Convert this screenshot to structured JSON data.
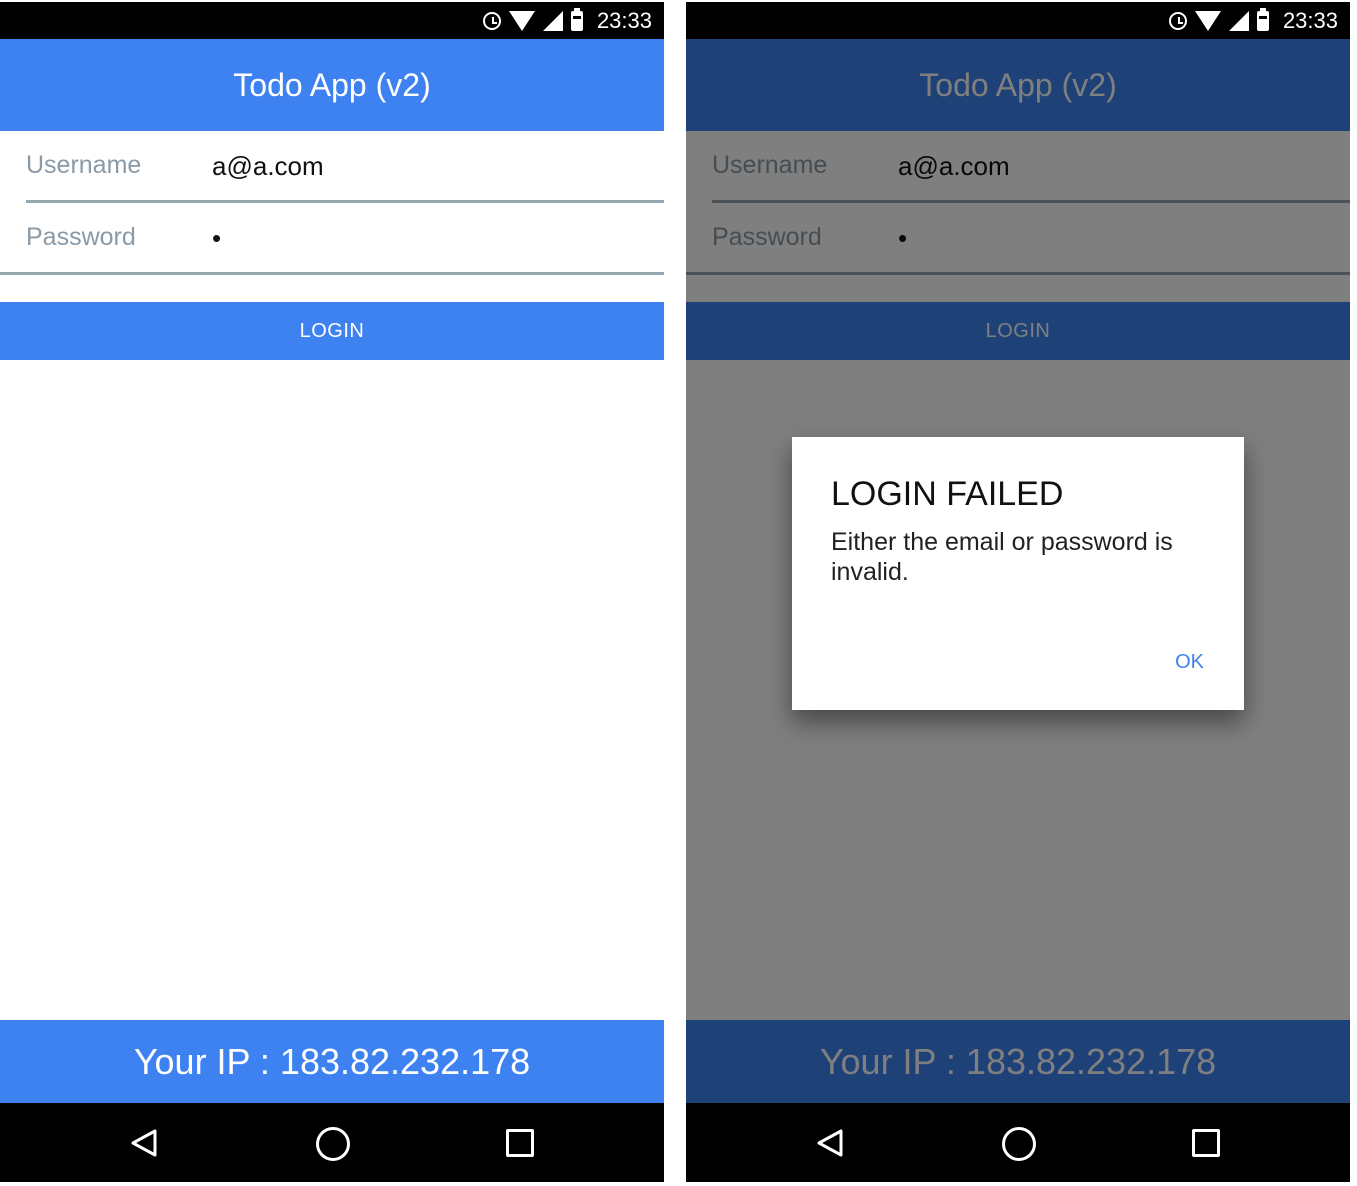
{
  "status_bar": {
    "time": "23:33"
  },
  "app": {
    "title": "Todo App (v2)"
  },
  "form": {
    "username_label": "Username",
    "username_value": "a@a.com",
    "password_label": "Password",
    "password_value": "•"
  },
  "login_button": "LOGIN",
  "footer": {
    "ip_text": "Your IP : 183.82.232.178"
  },
  "dialog": {
    "title": "LOGIN FAILED",
    "message": "Either the email or password is invalid.",
    "ok_label": "OK"
  },
  "colors": {
    "primary": "#3d82f0",
    "label_gray": "#8a9aa6",
    "status_bar": "#000000",
    "scrim": "rgba(0,0,0,0.5)"
  }
}
